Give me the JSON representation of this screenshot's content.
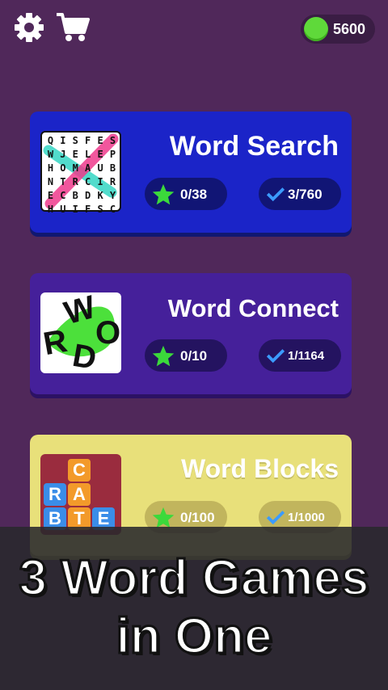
{
  "header": {
    "coins": "5600"
  },
  "games": [
    {
      "title": "Word Search",
      "stars": "0/38",
      "completed": "3/760"
    },
    {
      "title": "Word Connect",
      "stars": "0/10",
      "completed": "1/1164"
    },
    {
      "title": "Word Blocks",
      "stars": "0/100",
      "completed": "1/1000"
    }
  ],
  "word_search_grid": [
    [
      "Q",
      "I",
      "S",
      "F",
      "E",
      "S"
    ],
    [
      "W",
      "J",
      "E",
      "L",
      "E",
      "P"
    ],
    [
      "H",
      "O",
      "M",
      "A",
      "U",
      "B"
    ],
    [
      "N",
      "T",
      "R",
      "C",
      "I",
      "R"
    ],
    [
      "E",
      "C",
      "B",
      "D",
      "K",
      "Y"
    ],
    [
      "H",
      "U",
      "I",
      "F",
      "S",
      "C"
    ]
  ],
  "word_connect_letters": [
    "W",
    "O",
    "R",
    "D"
  ],
  "word_blocks_letters": [
    "C",
    "R",
    "A",
    "B",
    "T",
    "E"
  ],
  "banner": {
    "line1": "3 Word Games",
    "line2": "in One"
  },
  "colors": {
    "background": "#50285a",
    "word_search_card": "#1b24c8",
    "word_connect_card": "#45209a",
    "word_blocks_card": "#e8e07a",
    "star": "#3bd93b",
    "coin": "#5fd93a"
  },
  "icons": [
    "gear-icon",
    "cart-icon",
    "coin-icon",
    "star-icon",
    "check-icon"
  ]
}
